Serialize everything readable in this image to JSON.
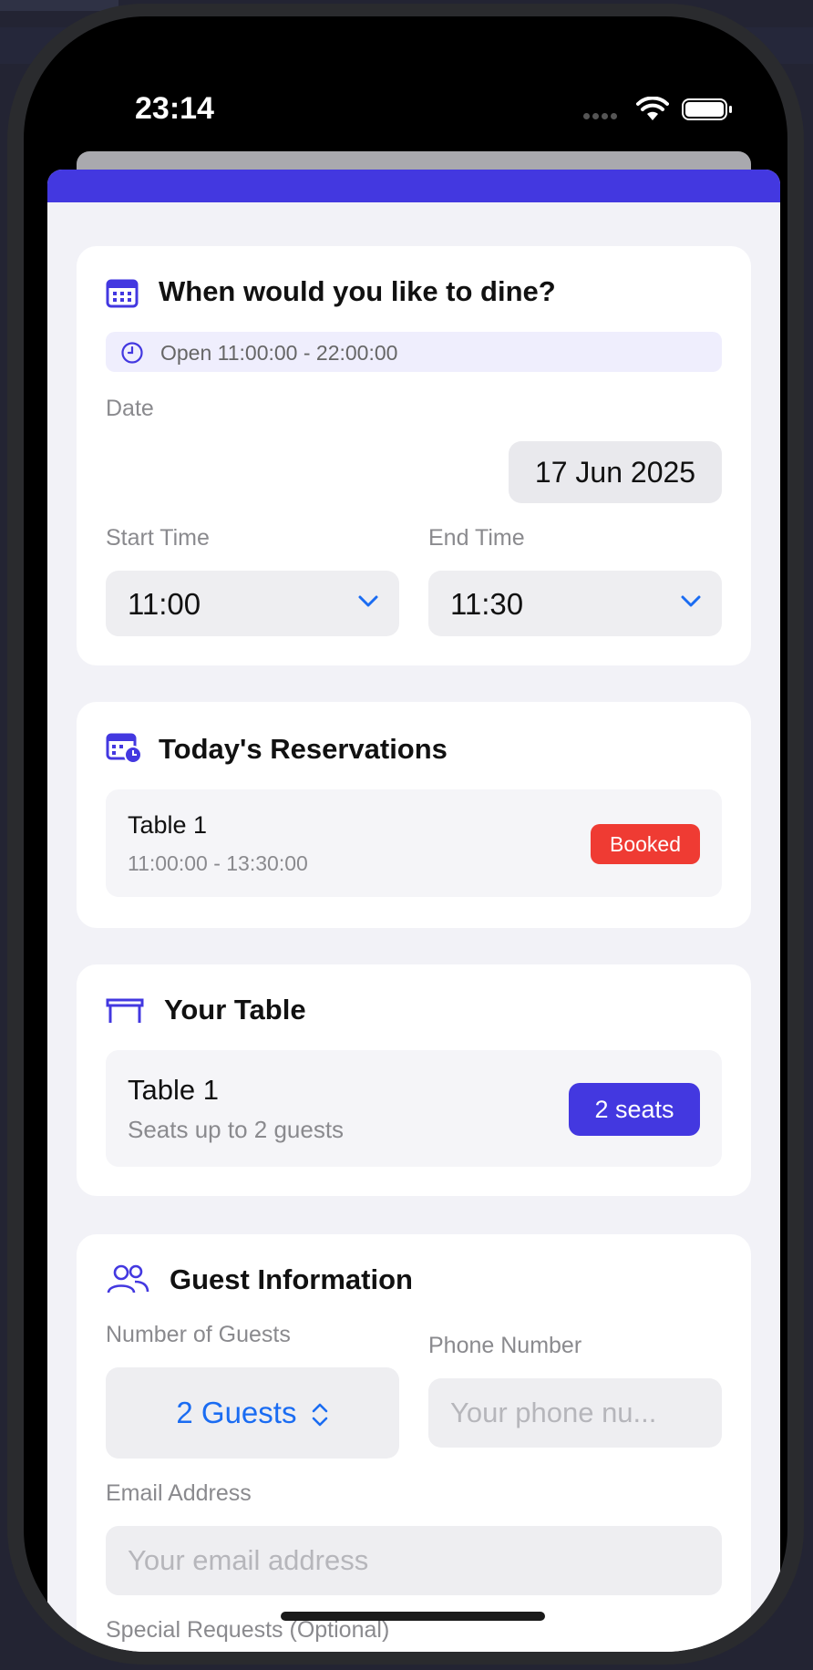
{
  "status_bar": {
    "time": "23:14"
  },
  "colors": {
    "accent": "#4338e0",
    "booked": "#ef3b33",
    "link": "#1a6cf2"
  },
  "dine_card": {
    "title": "When would you like to dine?",
    "hours": "Open 11:00:00 - 22:00:00",
    "date_label": "Date",
    "date_value": "17 Jun 2025",
    "start_label": "Start Time",
    "start_value": "11:00",
    "end_label": "End Time",
    "end_value": "11:30"
  },
  "reservations_card": {
    "title": "Today's Reservations",
    "items": [
      {
        "table": "Table 1",
        "time": "11:00:00 - 13:30:00",
        "status": "Booked"
      }
    ]
  },
  "table_card": {
    "title": "Your Table",
    "table_name": "Table 1",
    "capacity_text": "Seats up to 2 guests",
    "seats_badge": "2 seats"
  },
  "guest_card": {
    "title": "Guest Information",
    "guests_label": "Number of Guests",
    "guests_value": "2 Guests",
    "phone_label": "Phone Number",
    "phone_placeholder": "Your phone nu...",
    "email_label": "Email Address",
    "email_placeholder": "Your email address",
    "special_label": "Special Requests (Optional)"
  }
}
